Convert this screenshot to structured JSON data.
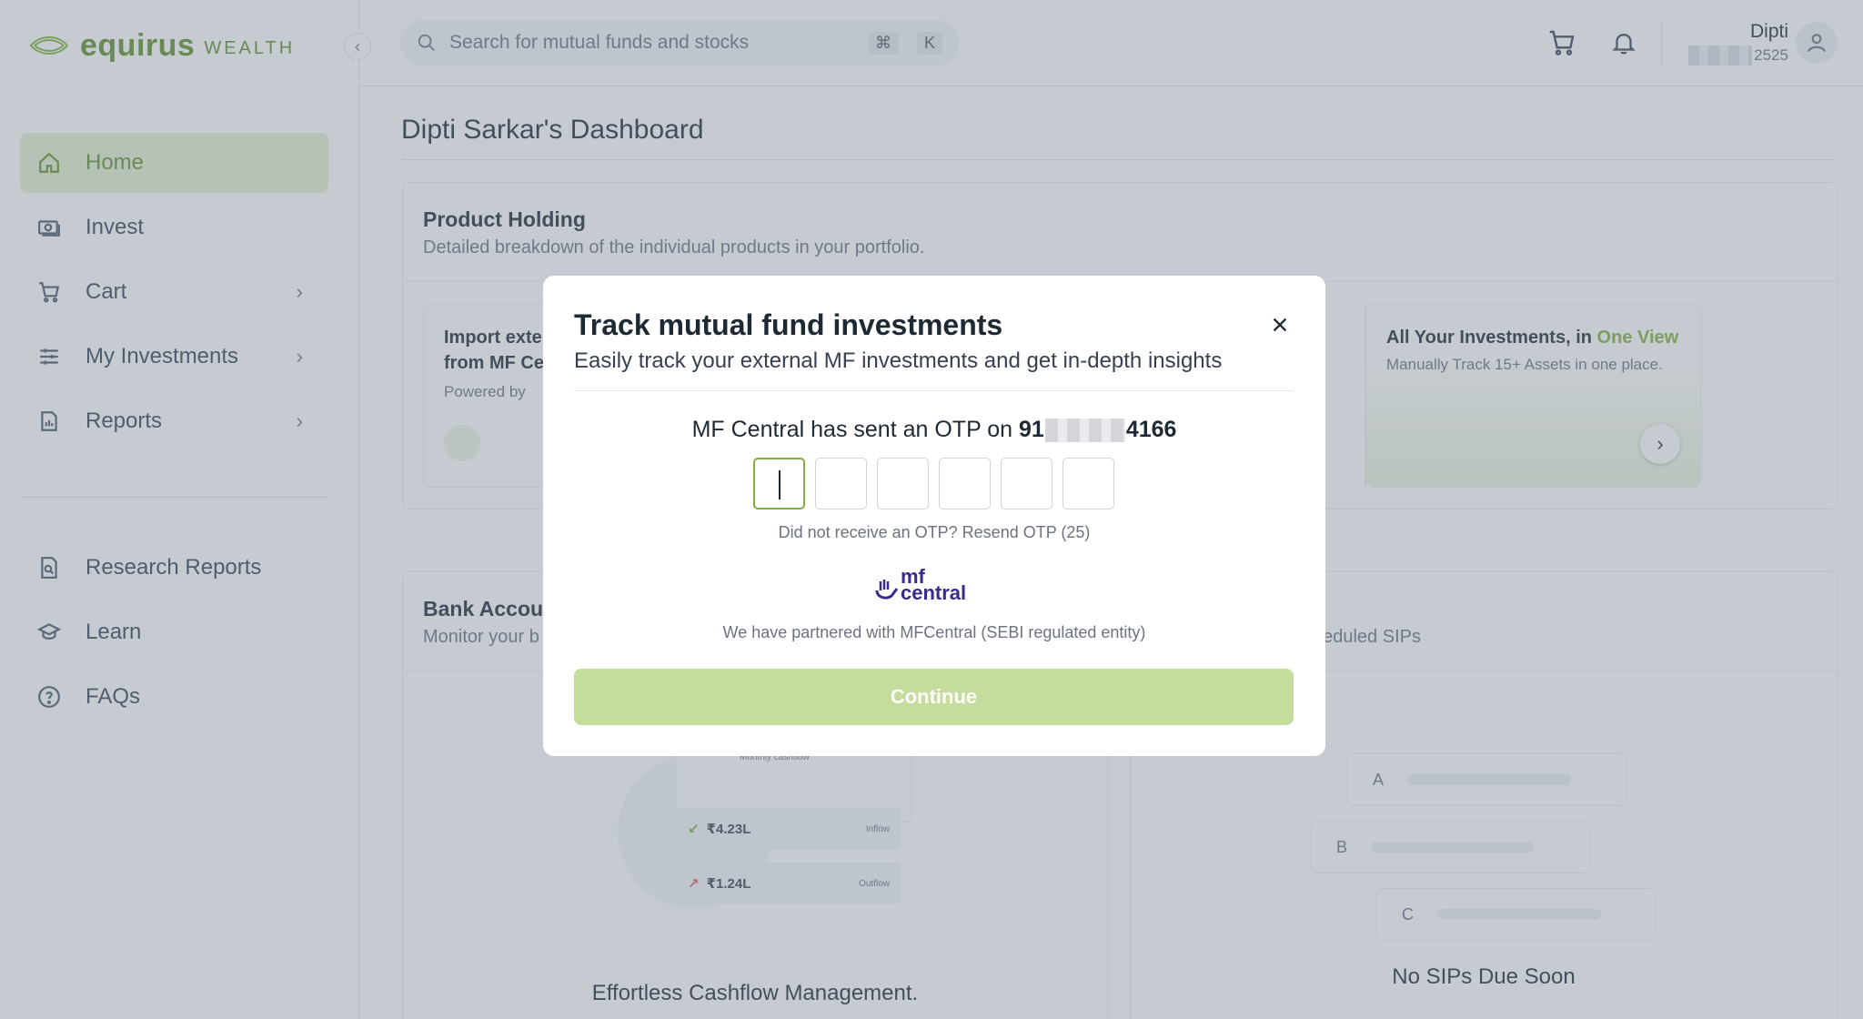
{
  "brand": {
    "name": "equirus",
    "sub": "WEALTH"
  },
  "search": {
    "placeholder": "Search for mutual funds and stocks",
    "shortcut_cmd": "⌘",
    "shortcut_key": "K"
  },
  "user": {
    "name": "Dipti",
    "id_suffix": "2525"
  },
  "sidebar": {
    "items": [
      {
        "label": "Home",
        "active": true
      },
      {
        "label": "Invest"
      },
      {
        "label": "Cart",
        "has_chevron": true
      },
      {
        "label": "My Investments",
        "has_chevron": true
      },
      {
        "label": "Reports",
        "has_chevron": true
      }
    ],
    "secondary": [
      {
        "label": "Research Reports"
      },
      {
        "label": "Learn"
      },
      {
        "label": "FAQs"
      }
    ]
  },
  "main": {
    "title": "Dipti Sarkar's Dashboard",
    "product_holding": {
      "title": "Product Holding",
      "subtitle": "Detailed breakdown of the individual products in your portfolio.",
      "import_card": {
        "line1": "Import exte",
        "line2": "from MF Ce",
        "powered": "Powered by"
      },
      "all_card": {
        "title_prefix": "All Your Investments, in ",
        "title_highlight": "One View",
        "subtitle": "Manually Track 15+ Assets in one place."
      }
    },
    "bank_accounts": {
      "title": "Bank Accour",
      "subtitle": "Monitor your b",
      "inflow_value": "₹4.23L",
      "inflow_tag": "Inflow",
      "outflow_value": "₹1.24L",
      "outflow_tag": "Outflow",
      "monthly_label": "Monthly cashflow",
      "footer": "Effortless Cashflow Management."
    },
    "sips": {
      "subtitle_tail": "heduled SIPs",
      "rows": [
        "A",
        "B",
        "C"
      ],
      "footer": "No SIPs Due Soon"
    }
  },
  "modal": {
    "title": "Track mutual fund investments",
    "subtitle": "Easily track your external MF investments and get in-depth insights",
    "otp_prefix": "MF Central has sent an OTP on ",
    "phone_start": "91",
    "phone_end": "4166",
    "otp_count": 6,
    "resend_text": "Did not receive an OTP?  Resend OTP (25)",
    "partner_logo_top": "mf",
    "partner_logo_bottom": "central",
    "partner_text": "We have partnered with MFCentral (SEBI regulated entity)",
    "continue_label": "Continue"
  },
  "colors": {
    "accent": "#7fb13c",
    "brand": "#5f8f2a",
    "button_disabled": "#c4dd9b"
  }
}
